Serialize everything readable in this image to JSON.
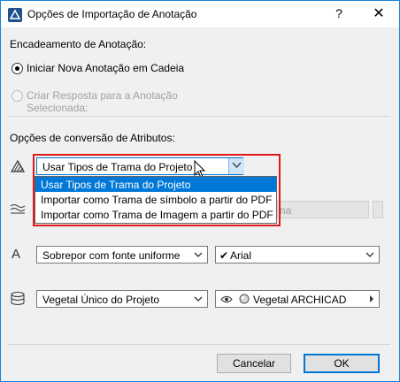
{
  "window": {
    "title": "Opções de Importação de Anotação",
    "help_glyph": "?",
    "close_glyph": "✕"
  },
  "chaining": {
    "heading": "Encadeamento de Anotação:",
    "option_new": "Iniciar Nova Anotação em Cadeia",
    "option_reply": "Criar Resposta para a Anotação Selecionada:",
    "selected": "option_new"
  },
  "conversion": {
    "heading": "Opções de conversão de Atributos:",
    "fill_combo_value": "Usar Tipos de Trama do Projeto",
    "fill_options": [
      "Usar Tipos de Trama do Projeto",
      "Importar como Trama de símbolo a partir do PDF",
      "Importar como Trama de Imagem a partir do PDF"
    ],
    "fill_options_selected_index": 0,
    "hidden_fill_fragment": "na",
    "font_mode_value": "Sobrepor com fonte uniforme",
    "font_value": "Arial",
    "font_check": "✔",
    "surface_value": "Vegetal Único do Projeto",
    "surface_material": "Vegetal ARCHICAD"
  },
  "footer": {
    "cancel_label": "Cancelar",
    "ok_label": "OK"
  },
  "colors": {
    "accent": "#0078d7",
    "highlight_border": "#e0191b",
    "window_border": "#1883d7"
  }
}
